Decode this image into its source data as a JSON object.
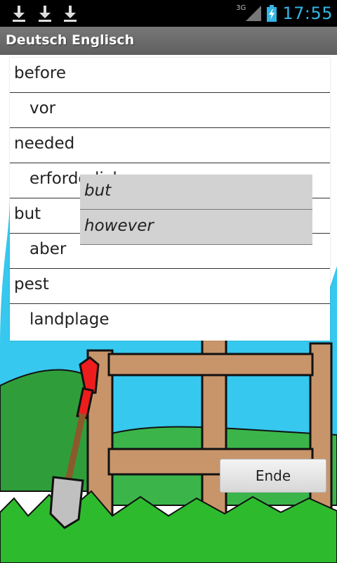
{
  "status_bar": {
    "icons": [
      "download-icon",
      "download-icon",
      "download-icon"
    ],
    "network_label": "3G",
    "battery_icon": "battery-charging-icon",
    "signal_icon": "signal-icon",
    "time": "17:55"
  },
  "app_bar": {
    "title": "Deutsch Englisch"
  },
  "word_list": [
    {
      "text": "before",
      "lang": "en"
    },
    {
      "text": "vor",
      "lang": "de"
    },
    {
      "text": "needed",
      "lang": "en"
    },
    {
      "text": "erforderlich",
      "lang": "de"
    },
    {
      "text": "but",
      "lang": "en"
    },
    {
      "text": "aber",
      "lang": "de"
    },
    {
      "text": "pest",
      "lang": "en"
    },
    {
      "text": "landplage",
      "lang": "de"
    }
  ],
  "popup": {
    "items": [
      "but",
      "however"
    ]
  },
  "footer": {
    "end_button_label": "Ende"
  },
  "colors": {
    "sky": "#33ccee",
    "grass": "#2eb82e",
    "wood": "#c8956a",
    "accent": "#33b5e5"
  }
}
